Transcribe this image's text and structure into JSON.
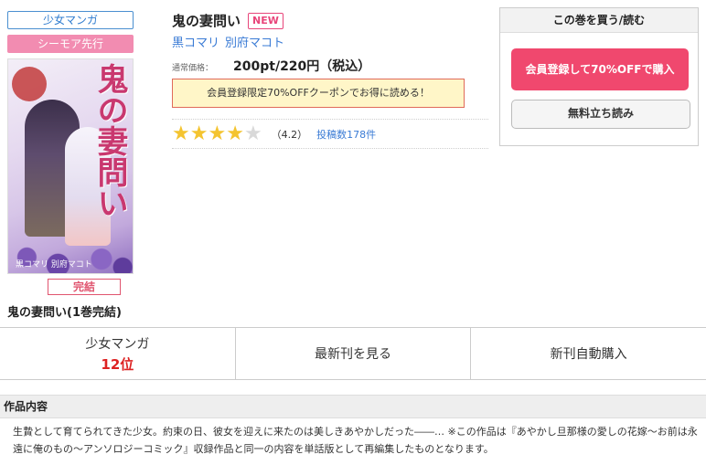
{
  "left": {
    "genre_tag": "少女マンガ",
    "preview_tag": "シーモア先行",
    "cover_title_art": "鬼の妻問い",
    "cover_authors_art": "黒コマリ 別府マコト",
    "status": "完結",
    "series_name": "鬼の妻問い(1巻完結)"
  },
  "book": {
    "title": "鬼の妻問い",
    "new_badge": "NEW",
    "authors": [
      "黒コマリ",
      "別府マコト"
    ],
    "price_label": "通常価格：",
    "price": "200pt/220円（税込）",
    "coupon_text": "会員登録限定70%OFFクーポンでお得に読める！",
    "rating_value": "（4.2）",
    "rating_stars": 4.2,
    "reviews_link": "投稿数178件"
  },
  "buy_panel": {
    "heading": "この巻を買う/読む",
    "buy_button": "会員登録して70%OFFで購入",
    "free_button": "無料立ち読み",
    "accent_color": "#f0486e"
  },
  "nav": {
    "rank_category": "少女マンガ",
    "rank_value": "12位",
    "latest_label": "最新刊を見る",
    "auto_buy_label": "新刊自動購入"
  },
  "synopsis": {
    "heading": "作品内容",
    "text": "生贄として育てられてきた少女。約束の日、彼女を迎えに来たのは美しきあやかしだった――… ※この作品は『あやかし旦那様の愛しの花嫁～お前は永遠に俺のもの～アンソロジーコミック』収録作品と同一の内容を単話版として再編集したものとなります。"
  },
  "icons": {
    "star": "star-icon"
  }
}
